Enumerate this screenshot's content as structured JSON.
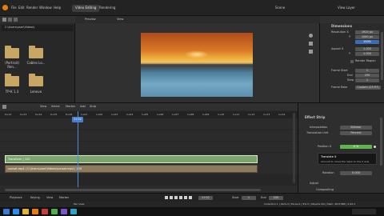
{
  "topbar": {
    "menus": [
      "File",
      "Edit",
      "Render",
      "Window",
      "Help"
    ],
    "workspaces": [
      "Video Editing",
      "Rendering"
    ],
    "scene_label": "Scene",
    "view_layer_label": "View Layer"
  },
  "filebrowser": {
    "path": "C:\\Users\\user\\Videos\\",
    "folders": [
      {
        "label": "(Portrait) Ren..."
      },
      {
        "label": "Cables Lo..."
      },
      {
        "label": "TP-K 1.3"
      },
      {
        "label": "Lenovo"
      }
    ]
  },
  "preview": {
    "view_label": "Preview",
    "view_menu": "View"
  },
  "properties": {
    "section_dimensions": "Dimensions",
    "resolution_x_label": "Resolution X",
    "resolution_x": "1920 px",
    "resolution_y_label": "Y",
    "resolution_y": "1080 px",
    "percent": "100%",
    "aspect_x_label": "Aspect X",
    "aspect_x": "1.000",
    "aspect_y_label": "Y",
    "aspect_y": "1.000",
    "render_region": "Render Region",
    "frame_start_label": "Frame Start",
    "frame_start": "1",
    "frame_end_label": "End",
    "frame_end": "250",
    "step_label": "Step",
    "step": "1",
    "frame_rate_label": "Frame Rate",
    "frame_rate": "Custom (29.97)"
  },
  "sequencer": {
    "menus": [
      "View",
      "Select",
      "Marker",
      "Add",
      "Strip"
    ],
    "ruler_ticks": [
      "0+12",
      "0+13",
      "0+14",
      "0+15",
      "0+16",
      "1+01",
      "1+02",
      "1+03",
      "1+04",
      "1+05",
      "1+06",
      "1+07",
      "1+08",
      "1+09",
      "1+10",
      "1+11",
      "1+12",
      "1+13",
      "1+14"
    ],
    "current_frame": "1+02",
    "strip_transform_label": "Transform | 120",
    "strip_video_label": "sunset.mp4 | C:\\Users\\user\\Videos\\sunset.mp4 | 120"
  },
  "stripside": {
    "title": "Effect Strip",
    "interp_label": "Interpolation",
    "interp_value": "Bilinear",
    "translation_label": "Translation Unit",
    "translation_value": "Percent",
    "position_label": "Position X",
    "position_value": "0 %",
    "tooltip_title": "Translate X",
    "tooltip_body": "Amount to move the input on the X axis",
    "rotation_label": "Rotation",
    "rotation_value": "0.000",
    "adjust_label": "Adjust",
    "compositing_label": "Compositing"
  },
  "playback": {
    "playback_label": "Playback",
    "keying_label": "Keying",
    "view_label": "View",
    "marker_label": "Marker",
    "frame": "1+02",
    "start_label": "Start",
    "start": "1",
    "end_label": "End",
    "end": "250"
  },
  "statusbar": {
    "left": "Pan View",
    "right": "Collection 1 | Verts 0 | Faces 0 | Tris 0 | Objects 0/0 | Mem: 48.8 MiB | 2.93.4"
  },
  "colors": {
    "accent_blue": "#4a90d9",
    "strip_green": "#7aa36d",
    "strip_video": "#8d7b5f"
  }
}
